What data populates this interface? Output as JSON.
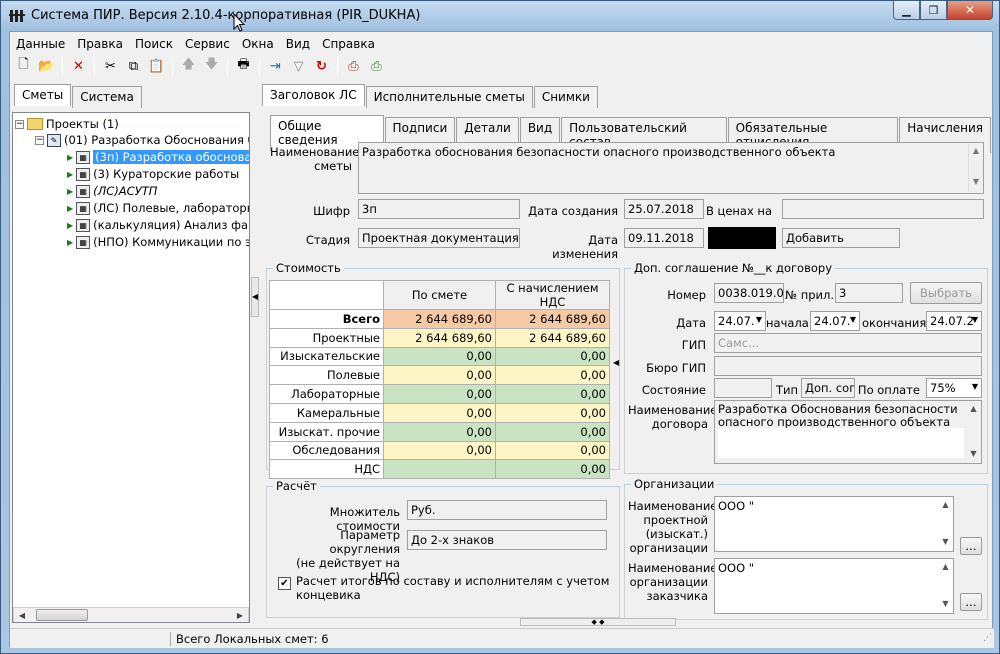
{
  "window": {
    "title": "Система ПИР. Версия 2.10.4-корпоративная (PIR_DUKHA)",
    "controls": [
      "▁",
      "❐",
      "✕"
    ]
  },
  "menu": [
    "Данные",
    "Правка",
    "Поиск",
    "Сервис",
    "Окна",
    "Вид",
    "Справка"
  ],
  "left_tabs": [
    "Сметы",
    "Система"
  ],
  "tree": [
    {
      "label": "Проекты (1)",
      "icon": "folder-icon"
    },
    {
      "label": "(01) Разработка Обоснования б",
      "icon": "project-icon"
    },
    {
      "label": "(3п) Разработка  обосновани",
      "icon": "estimate-icon"
    },
    {
      "label": "(3) Кураторские работы",
      "icon": "estimate-icon"
    },
    {
      "label": "(ЛС)АСУТП",
      "icon": "estimate-icon"
    },
    {
      "label": "(ЛС) Полевые, лабораторны",
      "icon": "estimate-icon"
    },
    {
      "label": "(калькуляция) Анализ факти",
      "icon": "estimate-icon"
    },
    {
      "label": "(НПО) Коммуникации по экс",
      "icon": "estimate-icon"
    }
  ],
  "top_tabs": [
    "Заголовок ЛС",
    "Исполнительные сметы",
    "Снимки"
  ],
  "sub_tabs": [
    "Общие сведения",
    "Подписи",
    "Детали",
    "Вид",
    "Пользовательский состав",
    "Обязательные отчисления",
    "Начисления"
  ],
  "general": {
    "name_label": "Наименование сметы",
    "name_value": "Разработка  обоснования безопасности опасного производственного объекта",
    "code_label": "Шифр",
    "code_value": "3п",
    "created_label": "Дата создания",
    "created_value": "25.07.2018",
    "prices_label": "В ценах на",
    "prices_value": "",
    "stage_label": "Стадия",
    "stage_value": "Проектная документация",
    "modified_label": "Дата изменения",
    "modified_value": "09.11.2018",
    "add_button": "Добавить"
  },
  "cost": {
    "title": "Стоимость",
    "headers": [
      "",
      "По смете",
      "С начислением НДС"
    ],
    "rows": [
      {
        "label": "Всего",
        "v1": "2 644 689,60",
        "v2": "2 644 689,60",
        "bold": true
      },
      {
        "label": "Проектные",
        "v1": "2 644 689,60",
        "v2": "2 644 689,60"
      },
      {
        "label": "Изыскательские",
        "v1": "0,00",
        "v2": "0,00"
      },
      {
        "label": "Полевые",
        "v1": "0,00",
        "v2": "0,00"
      },
      {
        "label": "Лабораторные",
        "v1": "0,00",
        "v2": "0,00"
      },
      {
        "label": "Камеральные",
        "v1": "0,00",
        "v2": "0,00"
      },
      {
        "label": "Изыскат. прочие",
        "v1": "0,00",
        "v2": "0,00"
      },
      {
        "label": "Обследования",
        "v1": "0,00",
        "v2": "0,00"
      },
      {
        "label": "НДС",
        "v1": "",
        "v2": "0,00"
      }
    ]
  },
  "calc": {
    "title": "Расчёт",
    "multiplier_label": "Множитель стоимости",
    "multiplier_value": "Руб.",
    "rounding_label1": "Параметр округления",
    "rounding_label2": "(не действует на НДС)",
    "rounding_value": "До 2-х знаков",
    "checkbox_label1": "Расчет итогов по составу и исполнителям с учетом",
    "checkbox_label2": "концевика",
    "checkbox_checked": true
  },
  "agreement": {
    "title": "Доп. соглашение №__к договору",
    "number_label": "Номер",
    "number_value": "0038.019.00",
    "app_label": "№ прил.",
    "app_value": "3",
    "choose_button": "Выбрать",
    "date_label": "Дата",
    "date_value": "24.07.",
    "start_label": "начала",
    "start_value": "24.07.",
    "end_label": "окончания",
    "end_value": "24.07.2",
    "gip_label": "ГИП",
    "gip_value": "Самс...",
    "bureau_label": "Бюро ГИП",
    "bureau_value": "",
    "state_label": "Состояние",
    "state_value": "",
    "type_label": "Тип",
    "type_value": "Доп. согл",
    "payment_label": "По оплате",
    "payment_value": "75%",
    "contract_label1": "Наименование",
    "contract_label2": "договора",
    "contract_value1": "Разработка Обоснования безопасности",
    "contract_value2": "опасного производственного объекта"
  },
  "orgs": {
    "title": "Организации",
    "design_label": [
      "Наименование",
      "проектной",
      "(изыскат.)",
      "организации"
    ],
    "design_value": "ООО \"",
    "customer_label": [
      "Наименование",
      "организации",
      "заказчика"
    ],
    "customer_value": "ООО \"",
    "dots": "..."
  },
  "status": {
    "text": "Всего Локальных смет: 6"
  }
}
